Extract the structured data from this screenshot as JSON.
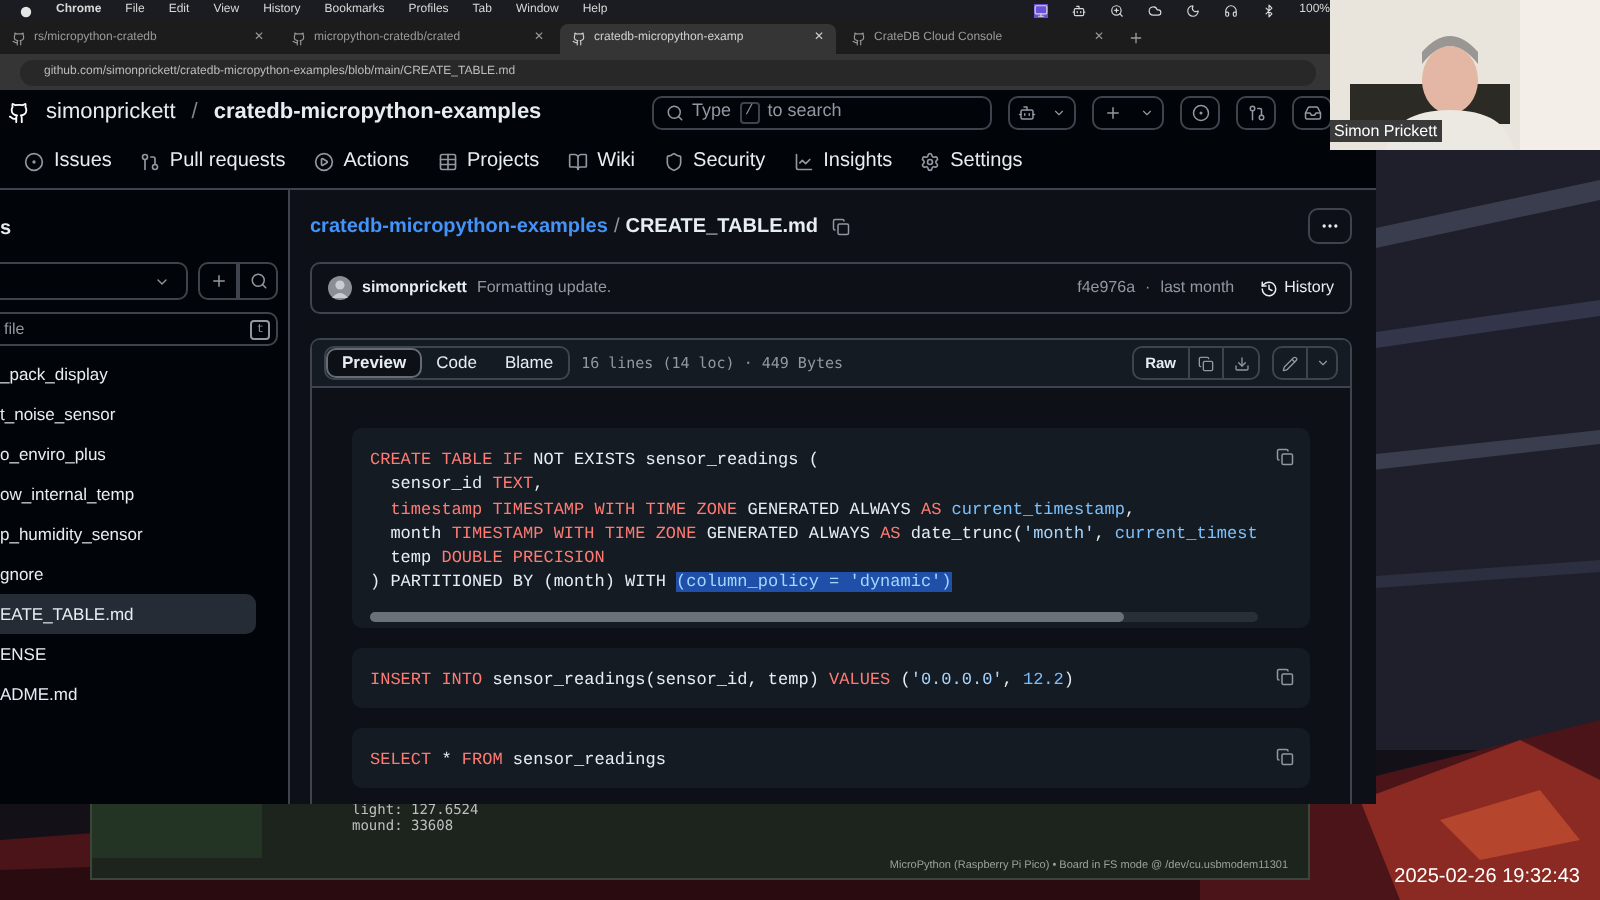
{
  "menubar": {
    "app": "Chrome",
    "menus": [
      "File",
      "Edit",
      "View",
      "History",
      "Bookmarks",
      "Profiles",
      "Tab",
      "Window",
      "Help"
    ],
    "battery": "100%"
  },
  "tabs": [
    {
      "label": "rs/micropython-cratedb",
      "close": "✕",
      "selected": false
    },
    {
      "label": "micropython-cratedb/crated",
      "close": "✕",
      "selected": false
    },
    {
      "label": "cratedb-micropython-examp",
      "close": "✕",
      "selected": true
    },
    {
      "label": "CrateDB Cloud Console",
      "close": "✕",
      "selected": false
    }
  ],
  "address": "github.com/simonprickett/cratedb-micropython-examples/blob/main/CREATE_TABLE.md",
  "repo": {
    "owner": "simonprickett",
    "separator": "/",
    "name": "cratedb-micropython-examples"
  },
  "search": {
    "before": "Type",
    "key": "/",
    "after": "to search"
  },
  "nav": [
    {
      "label": "Issues"
    },
    {
      "label": "Pull requests"
    },
    {
      "label": "Actions"
    },
    {
      "label": "Projects"
    },
    {
      "label": "Wiki"
    },
    {
      "label": "Security"
    },
    {
      "label": "Insights"
    },
    {
      "label": "Settings"
    }
  ],
  "sidebar": {
    "title": "s",
    "filter_placeholder": "file",
    "shortcut": "t",
    "files": [
      {
        "name": "_pack_display",
        "selected": false
      },
      {
        "name": "t_noise_sensor",
        "selected": false
      },
      {
        "name": "o_enviro_plus",
        "selected": false
      },
      {
        "name": "ow_internal_temp",
        "selected": false
      },
      {
        "name": "p_humidity_sensor",
        "selected": false
      },
      {
        "name": "gnore",
        "selected": false
      },
      {
        "name": "EATE_TABLE.md",
        "selected": true
      },
      {
        "name": "ENSE",
        "selected": false
      },
      {
        "name": "ADME.md",
        "selected": false
      }
    ]
  },
  "breadcrumb": {
    "repo": "cratedb-micropython-examples",
    "separator": "/",
    "file": "CREATE_TABLE.md"
  },
  "commit": {
    "author": "simonprickett",
    "message": "Formatting update.",
    "sha": "f4e976a",
    "dot": "·",
    "time": "last month",
    "history": "History"
  },
  "view_tabs": [
    {
      "label": "Preview",
      "selected": true
    },
    {
      "label": "Code",
      "selected": false
    },
    {
      "label": "Blame",
      "selected": false
    }
  ],
  "file_info": "16 lines (14 loc) · 449 Bytes",
  "raw": "Raw",
  "code_blocks": [
    {
      "scrollable": true,
      "lines": [
        [
          {
            "text": "CREATE TABLE IF",
            "kind": "kw"
          },
          {
            "text": " NOT EXISTS sensor_readings (",
            "kind": "plain"
          }
        ],
        [
          {
            "text": "  sensor_id ",
            "kind": "plain"
          },
          {
            "text": "TEXT",
            "kind": "kw"
          },
          {
            "text": ",",
            "kind": "plain"
          }
        ],
        [
          {
            "text": "  timestamp TIMESTAMP WITH TIME ZONE",
            "kind": "kw"
          },
          {
            "text": " GENERATED ALWAYS ",
            "kind": "plain"
          },
          {
            "text": "AS",
            "kind": "kw"
          },
          {
            "text": " current_timestamp",
            "kind": "fn"
          },
          {
            "text": ",",
            "kind": "plain"
          }
        ],
        [
          {
            "text": "  month ",
            "kind": "plain"
          },
          {
            "text": "TIMESTAMP WITH TIME ZONE",
            "kind": "kw"
          },
          {
            "text": " GENERATED ALWAYS ",
            "kind": "plain"
          },
          {
            "text": "AS",
            "kind": "kw"
          },
          {
            "text": " date_trunc(",
            "kind": "plain"
          },
          {
            "text": "'month'",
            "kind": "str"
          },
          {
            "text": ", ",
            "kind": "plain"
          },
          {
            "text": "current_timest",
            "kind": "fn"
          }
        ],
        [
          {
            "text": "  temp ",
            "kind": "plain"
          },
          {
            "text": "DOUBLE PRECISION",
            "kind": "kw"
          }
        ],
        [
          {
            "text": ") PARTITIONED BY (month) WITH ",
            "kind": "plain"
          },
          {
            "text": "(column_policy = 'dynamic')",
            "kind": "sel"
          }
        ]
      ]
    },
    {
      "scrollable": false,
      "lines": [
        [
          {
            "text": "INSERT INTO",
            "kind": "kw"
          },
          {
            "text": " sensor_readings(sensor_id, temp) ",
            "kind": "plain"
          },
          {
            "text": "VALUES",
            "kind": "kw"
          },
          {
            "text": " (",
            "kind": "plain"
          },
          {
            "text": "'0.0.0.0'",
            "kind": "str"
          },
          {
            "text": ", ",
            "kind": "plain"
          },
          {
            "text": "12.2",
            "kind": "fn"
          },
          {
            "text": ")",
            "kind": "plain"
          }
        ]
      ]
    },
    {
      "scrollable": false,
      "lines": [
        [
          {
            "text": "SELECT",
            "kind": "kw"
          },
          {
            "text": " * ",
            "kind": "plain"
          },
          {
            "text": "FROM",
            "kind": "kw"
          },
          {
            "text": " sensor_readings",
            "kind": "plain"
          }
        ]
      ]
    }
  ],
  "terminal": {
    "lines": [
      "light: 127.6524",
      "mound: 33608"
    ],
    "status": "MicroPython (Raspberry Pi Pico)  •  Board in FS mode @ /dev/cu.usbmodem11301"
  },
  "webcam": {
    "name": "Simon Prickett"
  },
  "clock": "2025-02-26 19:32:43"
}
